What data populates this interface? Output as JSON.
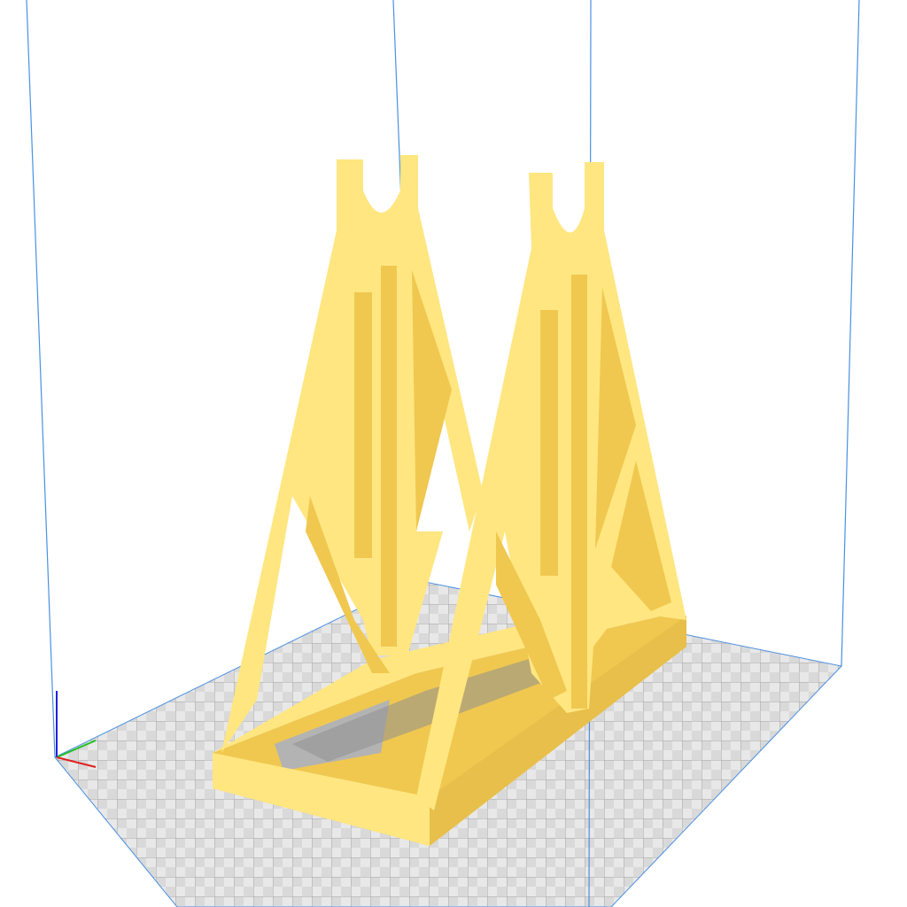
{
  "viewport": {
    "background": "#ffffff",
    "build_volume_line_color": "#4a90e2",
    "plate_color": "#d6d6d6",
    "plate_grid_color": "#9a9a9a",
    "axis_colors": {
      "x": "#e02020",
      "y": "#20c020",
      "z": "#2020e0"
    }
  },
  "model": {
    "name_icon": "spool-holder-model",
    "fill_color": "#ffe680",
    "side_color": "#f0c850",
    "shadow_color": "#d8b040"
  }
}
